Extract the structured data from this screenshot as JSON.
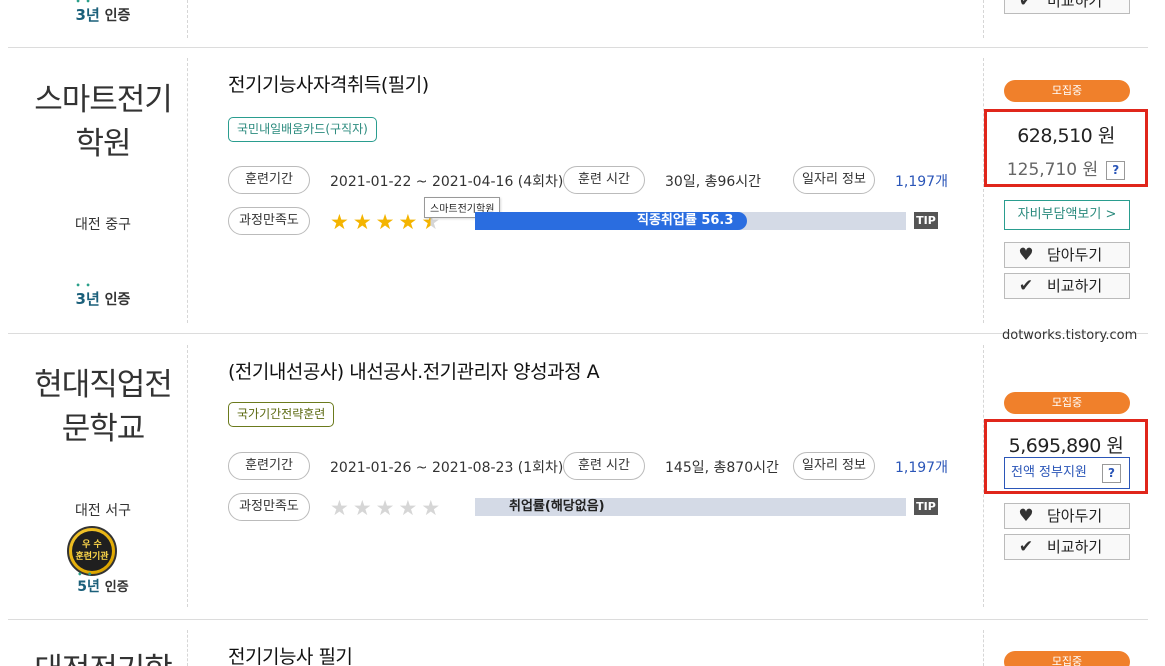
{
  "top_partial": {
    "cert_year": "3년",
    "cert_suffix": "인증",
    "compare_label": "비교하기"
  },
  "courses": [
    {
      "institution_line1": "스마트전기",
      "institution_line2": "학원",
      "region": "대전 중구",
      "cert_year": "3년",
      "cert_suffix": "인증",
      "title": "전기기능사자격취득(필기)",
      "tag": "국민내일배움카드(구직자)",
      "period_label": "훈련기간",
      "period_value": "2021-01-22 ~ 2021-04-16 (4회차)",
      "hours_label": "훈련 시간",
      "hours_value": "30일, 총96시간",
      "jobs_label": "일자리 정보",
      "jobs_value": "1,197개",
      "satisfaction_label": "과정만족도",
      "rating": 4.5,
      "bar_label": "직종취업률 56.3",
      "bar_rate": 0.63,
      "tip": "TIP",
      "tooltip": "스마트전기학원",
      "status": "모집중",
      "price": "628,510 원",
      "sub_price": "125,710 원",
      "qmark": "?",
      "self_pay_button": "자비부담액보기 >",
      "save_button": "담아두기",
      "compare_button": "비교하기"
    },
    {
      "institution_line1": "현대직업전",
      "institution_line2": "문학교",
      "region": "대전 서구",
      "badge_line1": "우 수",
      "badge_line2": "훈련기관",
      "cert_year": "5년",
      "cert_suffix": "인증",
      "title": "(전기내선공사) 내선공사.전기관리자 양성과정 A",
      "tag": "국가기간전략훈련",
      "period_label": "훈련기간",
      "period_value": "2021-01-26 ~ 2021-08-23 (1회차)",
      "hours_label": "훈련 시간",
      "hours_value": "145일, 총870시간",
      "jobs_label": "일자리 정보",
      "jobs_value": "1,197개",
      "satisfaction_label": "과정만족도",
      "rating": 0,
      "bar_label": "취업률(해당없음)",
      "tip": "TIP",
      "status": "모집중",
      "price": "5,695,890 원",
      "gov_support": "전액 정부지원",
      "qmark": "?",
      "save_button": "담아두기",
      "compare_button": "비교하기"
    },
    {
      "institution_line1": "대전전기학",
      "title": "전기기능사 필기",
      "status": "모집중"
    }
  ],
  "watermark": "dotworks.tistory.com"
}
